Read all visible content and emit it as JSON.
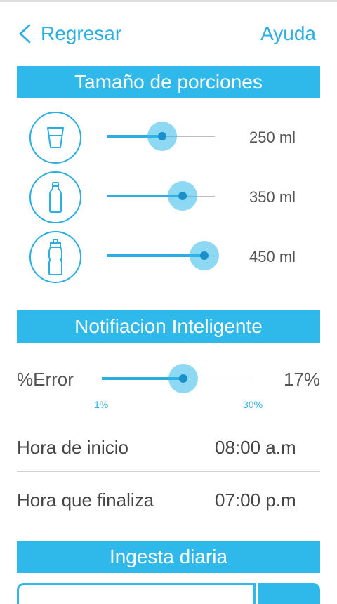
{
  "header": {
    "back_label": "Regresar",
    "help_label": "Ayuda"
  },
  "sections": {
    "portions_title": "Tamaño de porciones",
    "notification_title": "Notifiacion Inteligente",
    "daily_title": "Ingesta diaria"
  },
  "portions": [
    {
      "icon": "glass-icon",
      "value_label": "250 ml",
      "level": 0.51
    },
    {
      "icon": "bottle-icon",
      "value_label": "350 ml",
      "level": 0.7
    },
    {
      "icon": "sport-bottle-icon",
      "value_label": "450 ml",
      "level": 0.9
    }
  ],
  "notification": {
    "error_label": "%Error",
    "error_value": "17%",
    "min_label": "1%",
    "max_label": "30%",
    "level": 0.55
  },
  "times": {
    "start_label": "Hora de inicio",
    "start_value": "08:00 a.m",
    "end_label": "Hora que finaliza",
    "end_value": "07:00 p.m"
  },
  "colors": {
    "accent": "#2fb8ea",
    "text": "#4a4a4a"
  }
}
